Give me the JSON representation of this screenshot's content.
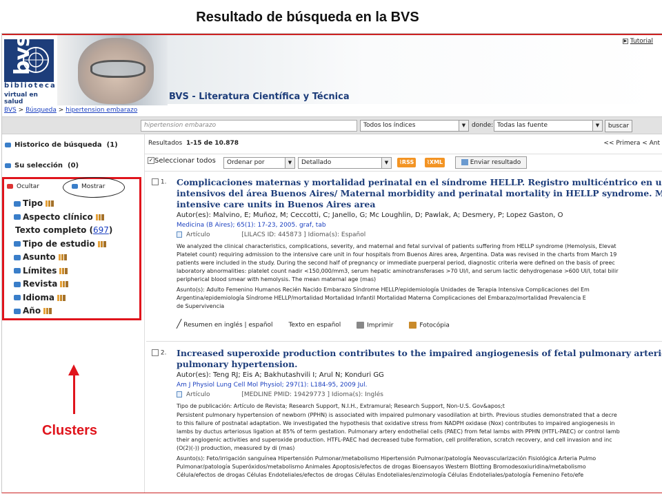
{
  "page_title": "Resultado de búsqueda en la BVS",
  "header": {
    "logo": {
      "line1": "biblioteca",
      "line2": "virtual en salud",
      "mark": "bvs"
    },
    "site_title": "BVS - Literatura Científica y Técnica",
    "tutorial": "Tutorial"
  },
  "breadcrumb": {
    "items": [
      "BVS",
      "Búsqueda",
      "hipertension embarazo"
    ],
    "separator": ">"
  },
  "search": {
    "query": "hipertension embarazo",
    "index_select": "Todos los índices",
    "donde_label": "donde:",
    "source_select": "Todas las fuente",
    "button": "buscar"
  },
  "sidebar": {
    "historico": {
      "label": "Historico de búsqueda",
      "count": "(1)"
    },
    "seleccion": {
      "label": "Su selección",
      "count": "(0)"
    },
    "clusters": {
      "ocultar": "Ocultar",
      "mostrar": "Mostrar",
      "items": [
        {
          "label": "Tipo",
          "bullet": true,
          "chart": true
        },
        {
          "label": "Aspecto clínico",
          "bullet": true,
          "chart": true
        },
        {
          "label": "Texto completo",
          "bullet": false,
          "chart": false,
          "count_open": "(",
          "count": "697",
          "count_close": ")"
        },
        {
          "label": "Tipo de estudio",
          "bullet": true,
          "chart": true
        },
        {
          "label": "Asunto",
          "bullet": true,
          "chart": true
        },
        {
          "label": "Límites",
          "bullet": true,
          "chart": true
        },
        {
          "label": "Revista",
          "bullet": true,
          "chart": true
        },
        {
          "label": "Idioma",
          "bullet": true,
          "chart": true
        },
        {
          "label": "Año",
          "bullet": true,
          "chart": true
        }
      ]
    },
    "annotation_label": "Clusters"
  },
  "results": {
    "label": "Resultados",
    "range": "1-15 de 10.878",
    "pager": "<< Primera < Ant",
    "toolbar": {
      "select_all": "Seleccionar todos",
      "order": "Ordenar por",
      "format": "Detallado",
      "rss": "RSS",
      "xml": "XML",
      "send": "Enviar resultado"
    },
    "records": [
      {
        "num": "1.",
        "title_lines": [
          "Complicaciones maternas y mortalidad perinatal en el síndrome HELLP. Registro multicéntrico en unidad",
          "intensivos del área Buenos Aires/ Maternal morbidity and perinatal mortality in HELLP syndrome. Multi",
          "intensive care units in Buenos Aires area"
        ],
        "authors": "Autor(es): Malvino, E; Muñoz, M; Ceccotti, C; Janello, G; Mc Loughlin, D; Pawlak, A; Desmery, P; Lopez Gaston, O",
        "journal": "Medicina (B Aires); 65(1): 17-23, 2005. graf, tab",
        "type": "Artículo",
        "ids": "[LILACS ID: 445873 ] Idioma(s): Español",
        "abstract_lines": [
          "We analyzed the clinical characteristics, complications, severity, and maternal and fetal survival of patients suffering from HELLP syndrome (Hemolysis, Elevat",
          "Platelet count) requiring admission to the intensive care unit in four hospitals from Buenos Aires area, Argentina. Data was revised in the charts from March 19",
          "patients were included in the study. During the second half of pregnancy or immediate puerperal period, diagnostic criteria were defined on the basis of preec",
          "laboratory abnormalities: platelet count nadir <150,000/mm3, serum hepatic aminotransferases >70 UI/l, and serum lactic dehydrogenase >600 UI/l, total bilir",
          "peripherical blood smear with hemolysis. The mean maternal age (mas)"
        ],
        "subject_lines": [
          "Asunto(s): Adulto   Femenino   Humanos   Recién Nacido   Embarazo   Síndrome HELLP/epidemiología   Unidades de Terapia Intensiva   Complicaciones del Em",
          "Argentina/epidemiología   Síndrome HELLP/mortalidad   Mortalidad Infantil   Mortalidad Materna   Complicaciones del Embarazo/mortalidad   Prevalencia   E",
          "de Supervivencia"
        ],
        "actions": [
          "Resumen en inglés | español",
          "Texto en español",
          "Imprimir",
          "Fotocópia"
        ]
      },
      {
        "num": "2.",
        "title_lines": [
          "Increased superoxide production contributes to the impaired angiogenesis of fetal pulmonary arteries wit",
          "pulmonary hypertension."
        ],
        "authors": "Autor(es): Teng RJ; Eis A; Bakhutashvili I; Arul N; Konduri GG",
        "journal": "Am J Physiol Lung Cell Mol Physiol; 297(1): L184-95, 2009 Jul.",
        "type": "Artículo",
        "ids": "[MEDLINE PMID: 19429773 ] Idioma(s): Inglés",
        "pub_type": "Tipo de publicación: Artículo de Revista; Research Support, N.I.H., Extramural; Research Support, Non-U.S. Gov&apos;t",
        "abstract_lines": [
          "Persistent pulmonary hypertension of newborn (PPHN) is associated with impaired pulmonary vasodilation at birth. Previous studies demonstrated that a decre",
          "to this failure of postnatal adaptation. We investigated the hypothesis that oxidative stress from NADPH oxidase (Nox) contributes to impaired angiogenesis in",
          "lambs by ductus arteriosus ligation at 85% of term gestation. Pulmonary artery endothelial cells (PAEC) from fetal lambs with PPHN (HTFL-PAEC) or control lamb",
          "their angiogenic activities and superoxide production. HTFL-PAEC had decreased tube formation, cell proliferation, scratch recovery, and cell invasion and inc",
          "(O(2)(-)) production, measured by di (mas)"
        ],
        "subject_lines": [
          "Asunto(s): Feto/irrigación sanguínea   Hipertensión Pulmonar/metabolismo   Hipertensión Pulmonar/patología   Neovascularización Fisiológica   Arteria Pulmo",
          "Pulmonar/patología   Superóxidos/metabolismo   Animales   Apoptosis/efectos de drogas   Bioensayos   Western Blotting   Bromodesoxiuridina/metabolismo",
          "Célula/efectos de drogas   Células Endoteliales/efectos de drogas   Células Endoteliales/enzimología   Células Endoteliales/patología   Femenino   Feto/efe"
        ]
      }
    ]
  }
}
